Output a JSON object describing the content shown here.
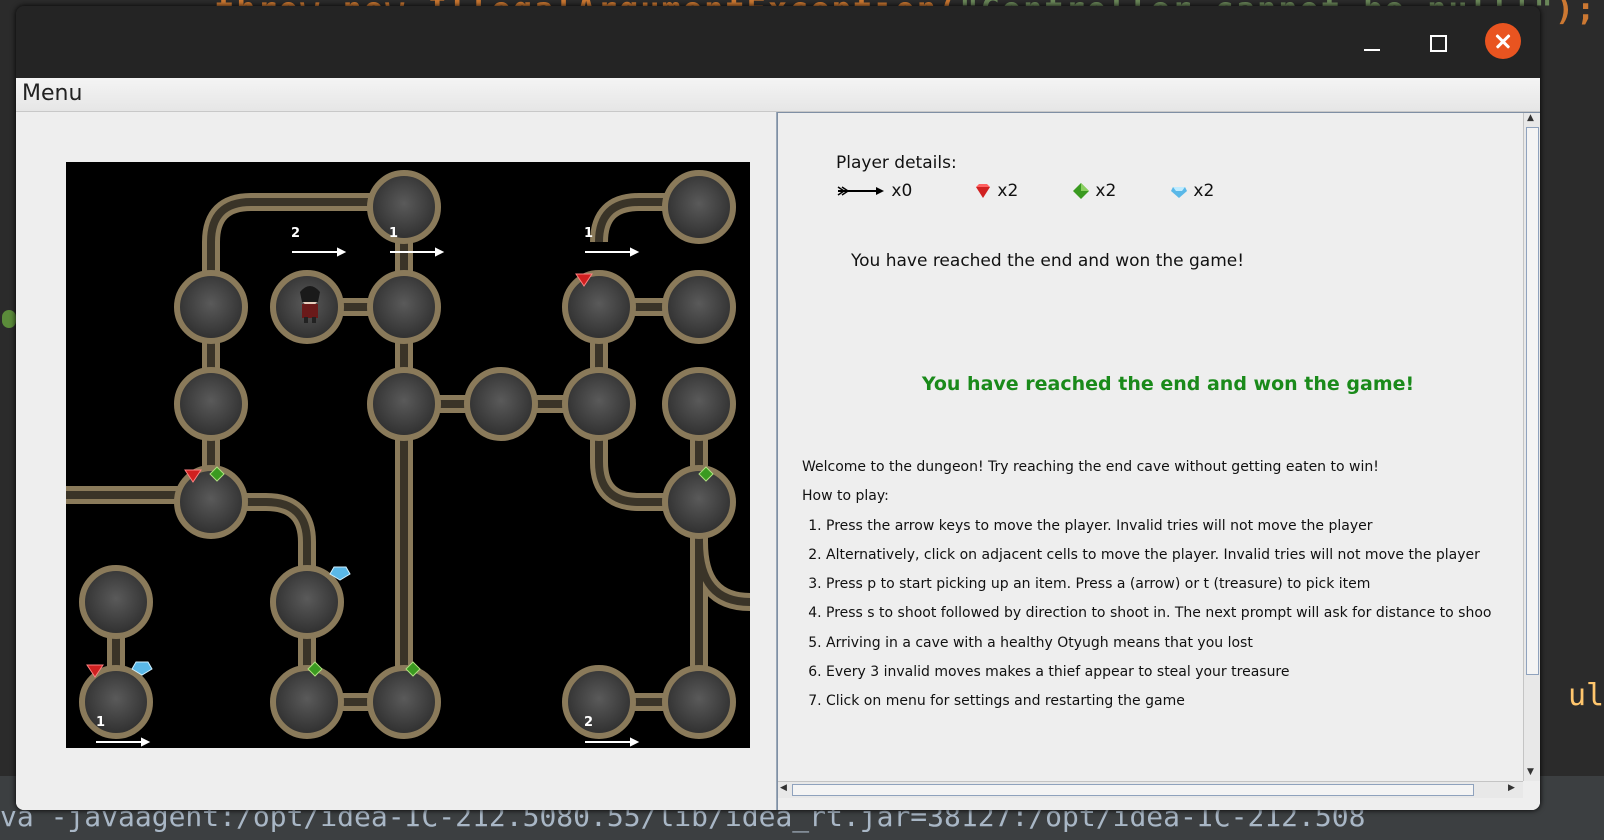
{
  "window": {
    "menu_label": "Menu"
  },
  "player": {
    "title": "Player details:",
    "arrows": "x0",
    "rubies": "x2",
    "diamonds": "x2",
    "sapphires": "x2"
  },
  "messages": {
    "status": "You have reached the end and won the game!",
    "win": "You have reached the end and won the game!"
  },
  "help": {
    "welcome": "Welcome to the dungeon! Try reaching the end cave without getting eaten to win!",
    "how_to": "How to play:",
    "steps": [
      "Press the arrow keys to move the player. Invalid tries will not move the player",
      "Alternatively, click on adjacent cells to move the player. Invalid tries will not move the player",
      "Press p to start picking up an item. Press a (arrow) or t (treasure) to pick item",
      "Press s to shoot followed by direction to shoot in. The next prompt will ask for distance to shoo",
      "Arriving in a cave with a healthy Otyugh means that you lost",
      "Every 3 invalid moves makes a thief appear to steal your treasure",
      "Click on menu for settings and restarting the game"
    ]
  },
  "map": {
    "arrow_labels": [
      "2",
      "1",
      "1",
      "1",
      "2"
    ]
  },
  "colors": {
    "win": "#1a8a1a",
    "close": "#e95420",
    "ruby": "#d02020",
    "diamond": "#3a9a20",
    "sapphire": "#5ab8e8"
  }
}
